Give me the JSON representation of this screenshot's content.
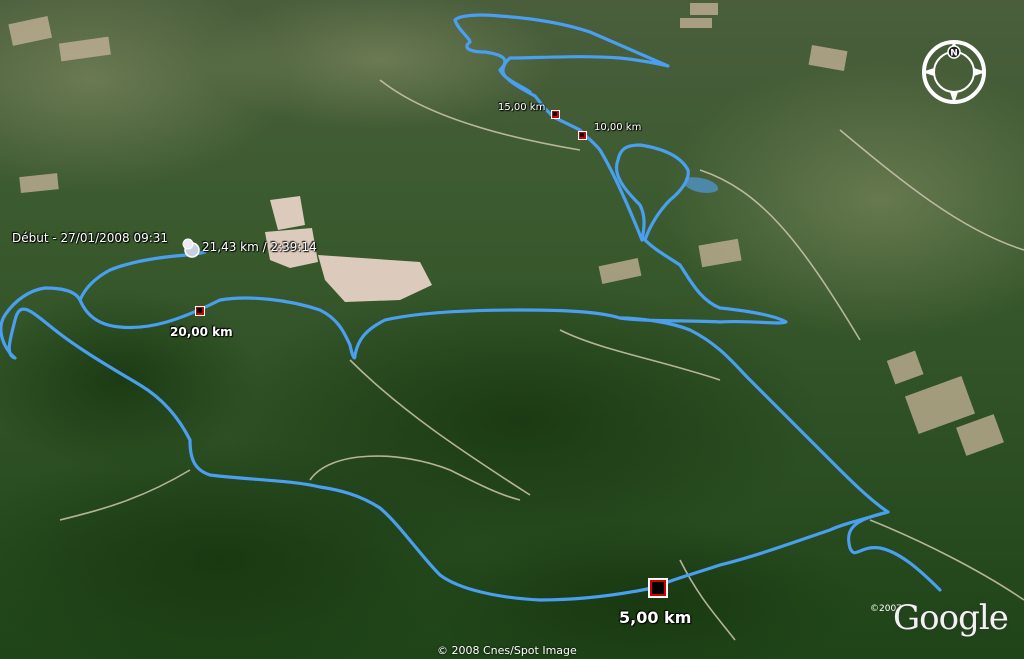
{
  "map": {
    "start_label": "Début - 27/01/2008 09:31",
    "end_label": "21,43 km / 2:39:14",
    "markers": [
      {
        "id": "km5",
        "label": "5,00 km"
      },
      {
        "id": "km10",
        "label": "10,00 km"
      },
      {
        "id": "km15",
        "label": "15,00 km"
      },
      {
        "id": "km20",
        "label": "20,00 km"
      }
    ],
    "compass_letter": "N",
    "attribution": "© 2008 Cnes/Spot Image",
    "logo_year": "©2007",
    "logo_text": "Google",
    "track_color": "#4a9ff0",
    "marker_color": "#d40000"
  }
}
